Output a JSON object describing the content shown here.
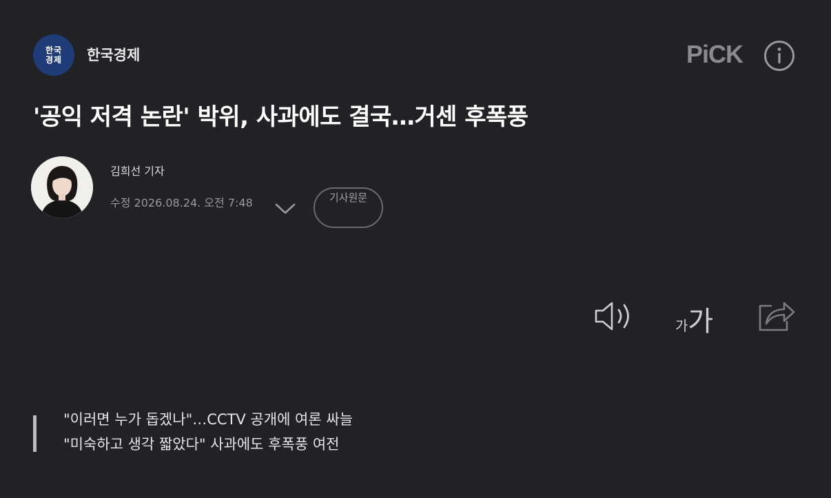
{
  "press": {
    "logo_line1": "한국",
    "logo_line2": "경제",
    "name": "한국경제",
    "pick_label": "PiCK"
  },
  "article": {
    "headline": "'공익 저격 논란' 박위, 사과에도 결국…거센 후폭풍",
    "reporter": "김희선 기자",
    "modified": "수정 2026.08.24. 오전 7:48",
    "origin_button": "기사원문",
    "font_small": "가",
    "font_big": "가",
    "summary": [
      "\"이러면 누가 돕겠나\"…CCTV 공개에 여론 싸늘",
      "\"미숙하고 생각 짧았다\" 사과에도 후폭풍 여전"
    ]
  },
  "icons": [
    "info-icon",
    "chevron-down-icon",
    "speaker-icon",
    "font-size-icon",
    "share-icon"
  ],
  "colors": {
    "background": "#222226",
    "logo_bg": "#1f3c78",
    "muted_text": "#9a9a9e"
  }
}
